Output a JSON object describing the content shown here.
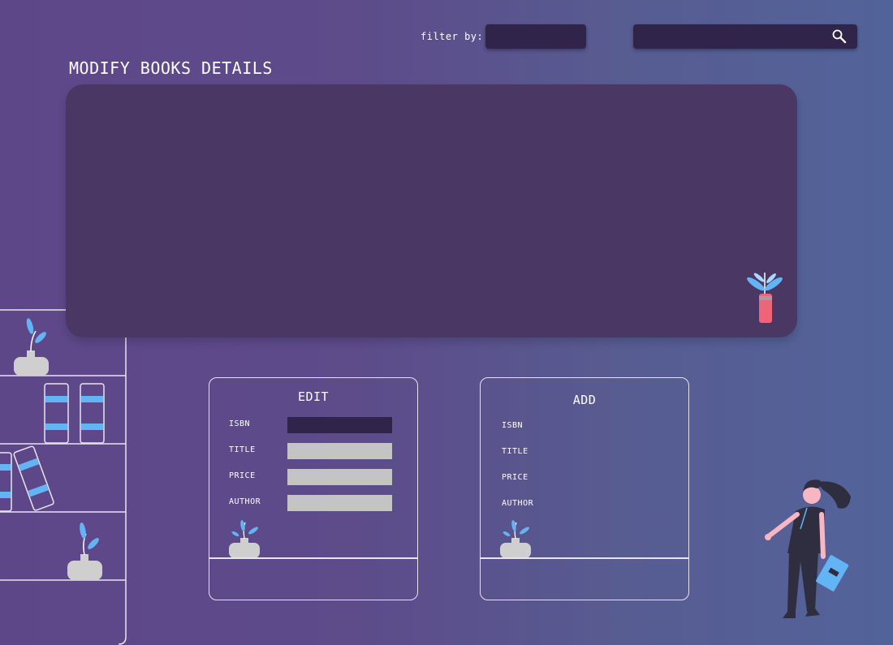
{
  "header": {
    "filter_label": "filter by:",
    "filter_value": "",
    "search_placeholder": "",
    "search_icon": "search-icon"
  },
  "main": {
    "title": "MODIFY BOOKS DETAILS"
  },
  "edit_form": {
    "title": "EDIT",
    "fields": [
      {
        "label": "ISBN",
        "value": ""
      },
      {
        "label": "TITLE",
        "value": ""
      },
      {
        "label": "PRICE",
        "value": ""
      },
      {
        "label": "AUTHOR",
        "value": ""
      }
    ]
  },
  "add_form": {
    "title": "ADD",
    "fields": [
      {
        "label": "ISBN"
      },
      {
        "label": "TITLE"
      },
      {
        "label": "PRICE"
      },
      {
        "label": "AUTHOR"
      }
    ]
  },
  "colors": {
    "panel": "#4b3764",
    "input_dark": "#31244b",
    "input_light": "#c4c4c4",
    "accent_blue": "#63b4f4",
    "accent_pink": "#f0647a"
  }
}
